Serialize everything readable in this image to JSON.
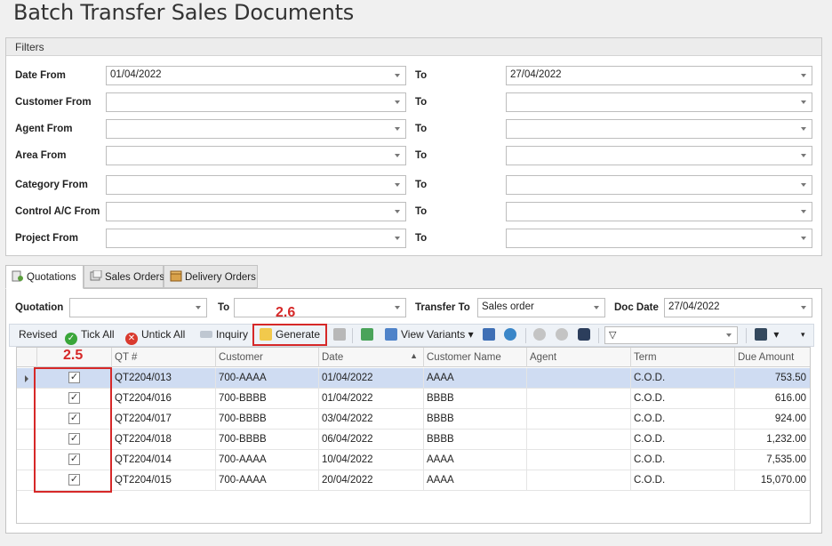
{
  "title": "Batch Transfer Sales Documents",
  "filters": {
    "header": "Filters",
    "rows": [
      {
        "label": "Date From",
        "from": "01/04/2022",
        "to_label": "To",
        "to": "27/04/2022"
      },
      {
        "label": "Customer From",
        "from": "",
        "to_label": "To",
        "to": ""
      },
      {
        "label": "Agent From",
        "from": "",
        "to_label": "To",
        "to": ""
      },
      {
        "label": "Area From",
        "from": "",
        "to_label": "To",
        "to": ""
      },
      {
        "label": "Category From",
        "from": "",
        "to_label": "To",
        "to": ""
      },
      {
        "label": "Control A/C From",
        "from": "",
        "to_label": "To",
        "to": ""
      },
      {
        "label": "Project From",
        "from": "",
        "to_label": "To",
        "to": ""
      }
    ]
  },
  "tabs": [
    {
      "label": "Quotations",
      "icon": "quotation-icon"
    },
    {
      "label": "Sales Orders",
      "icon": "sales-order-icon"
    },
    {
      "label": "Delivery Orders",
      "icon": "delivery-order-icon"
    }
  ],
  "criteria": {
    "quotation_label": "Quotation",
    "quotation_value": "",
    "to_label": "To",
    "to_value": "",
    "transfer_to_label": "Transfer To",
    "transfer_to_value": "Sales order",
    "doc_date_label": "Doc Date",
    "doc_date_value": "27/04/2022"
  },
  "toolbar": {
    "revised": "Revised",
    "tick_all": "Tick All",
    "untick_all": "Untick All",
    "inquiry": "Inquiry",
    "generate": "Generate",
    "view_variants": "View Variants",
    "filter_value": ""
  },
  "annotations": {
    "generate": "2.6",
    "checkbox_column": "2.5",
    "color": "#d62828"
  },
  "grid": {
    "columns": [
      "",
      "QT #",
      "Customer",
      "Date",
      "Customer Name",
      "Agent",
      "Term",
      "Due Amount"
    ],
    "rows": [
      {
        "checked": "✓",
        "qt": "QT2204/013",
        "customer": "700-AAAA",
        "date": "01/04/2022",
        "name": "AAAA",
        "agent": "",
        "term": "C.O.D.",
        "amount": "753.50"
      },
      {
        "checked": "✓",
        "qt": "QT2204/016",
        "customer": "700-BBBB",
        "date": "01/04/2022",
        "name": "BBBB",
        "agent": "",
        "term": "C.O.D.",
        "amount": "616.00"
      },
      {
        "checked": "✓",
        "qt": "QT2204/017",
        "customer": "700-BBBB",
        "date": "03/04/2022",
        "name": "BBBB",
        "agent": "",
        "term": "C.O.D.",
        "amount": "924.00"
      },
      {
        "checked": "✓",
        "qt": "QT2204/018",
        "customer": "700-BBBB",
        "date": "06/04/2022",
        "name": "BBBB",
        "agent": "",
        "term": "C.O.D.",
        "amount": "1,232.00"
      },
      {
        "checked": "✓",
        "qt": "QT2204/014",
        "customer": "700-AAAA",
        "date": "10/04/2022",
        "name": "AAAA",
        "agent": "",
        "term": "C.O.D.",
        "amount": "7,535.00"
      },
      {
        "checked": "✓",
        "qt": "QT2204/015",
        "customer": "700-AAAA",
        "date": "20/04/2022",
        "name": "AAAA",
        "agent": "",
        "term": "C.O.D.",
        "amount": "15,070.00"
      }
    ]
  }
}
